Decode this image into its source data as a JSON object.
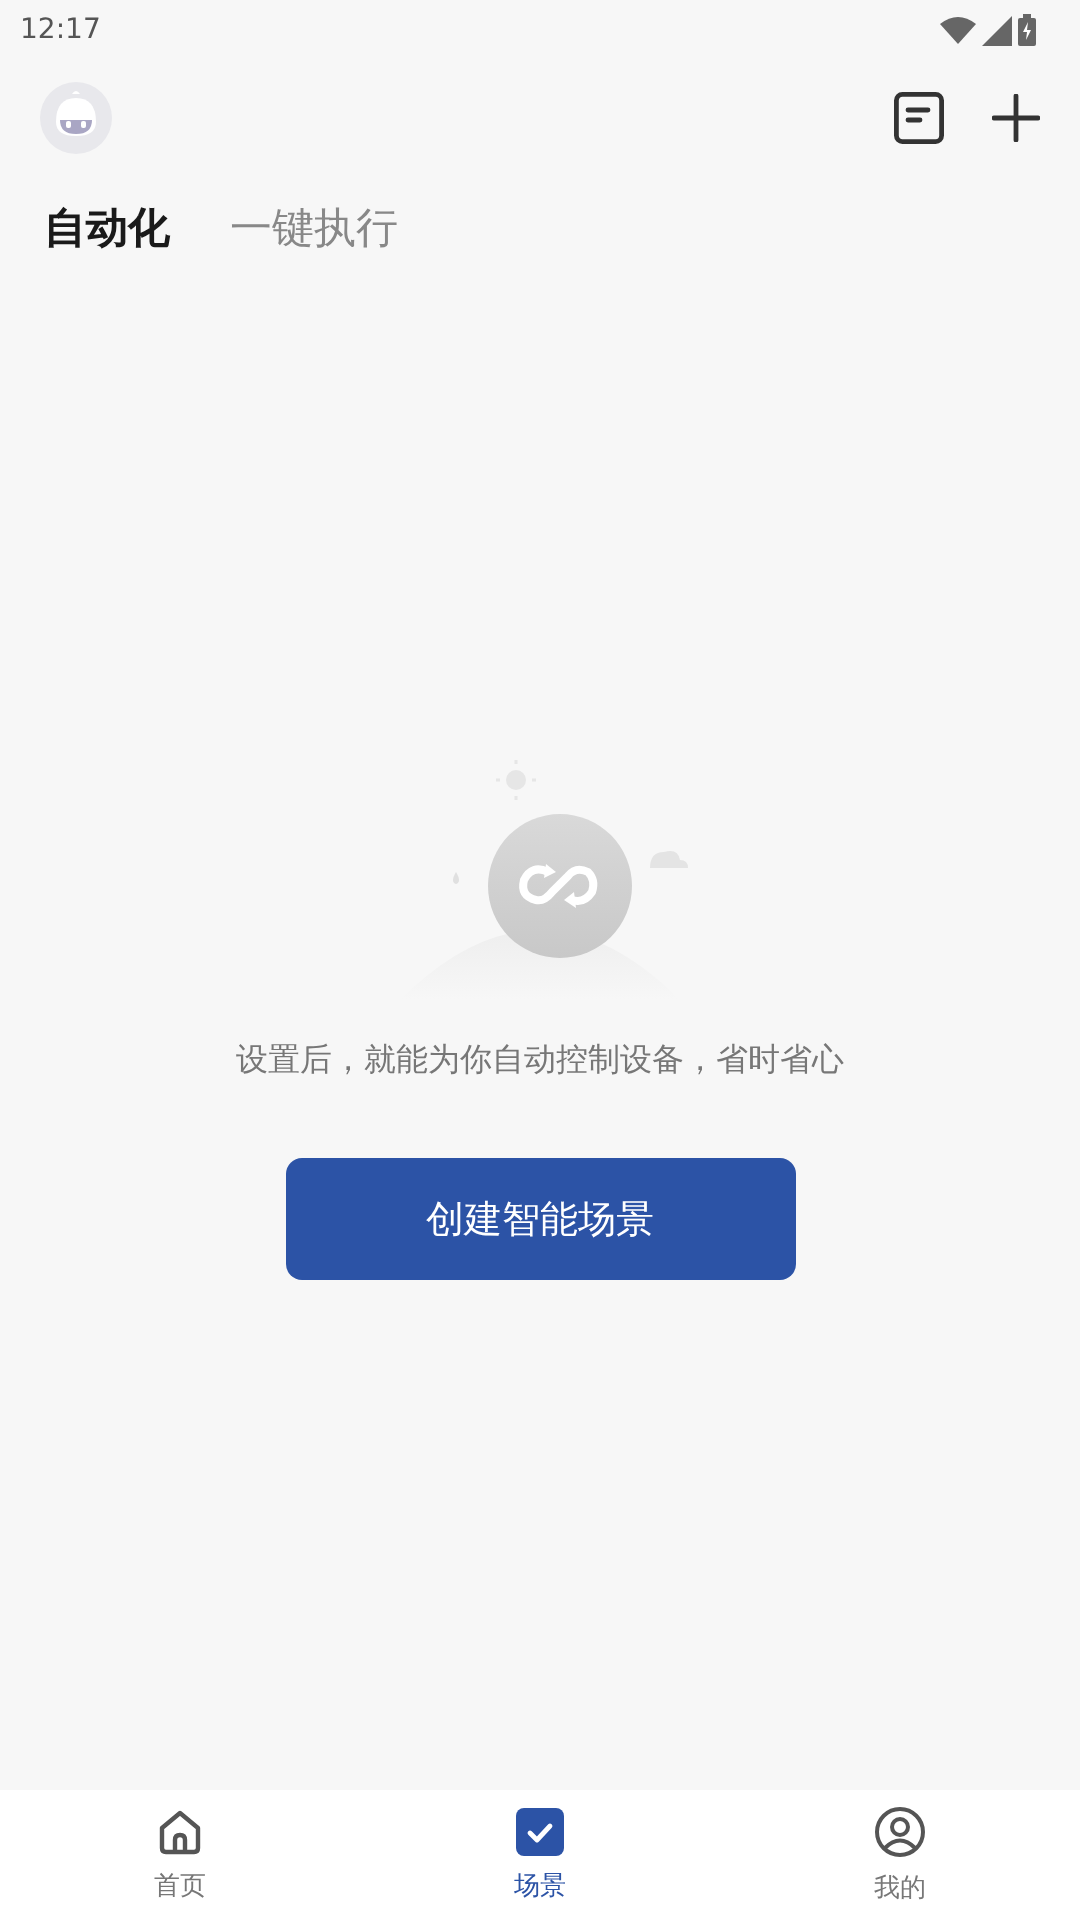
{
  "status_bar": {
    "time": "12:17"
  },
  "tabs": [
    {
      "label": "自动化",
      "selected": true
    },
    {
      "label": "一键执行",
      "selected": false
    }
  ],
  "empty_state": {
    "message": "设置后，就能为你自动控制设备，省时省心",
    "button": "创建智能场景"
  },
  "bottom_nav": [
    {
      "label": "首页",
      "selected": false
    },
    {
      "label": "场景",
      "selected": true
    },
    {
      "label": "我的",
      "selected": false
    }
  ]
}
